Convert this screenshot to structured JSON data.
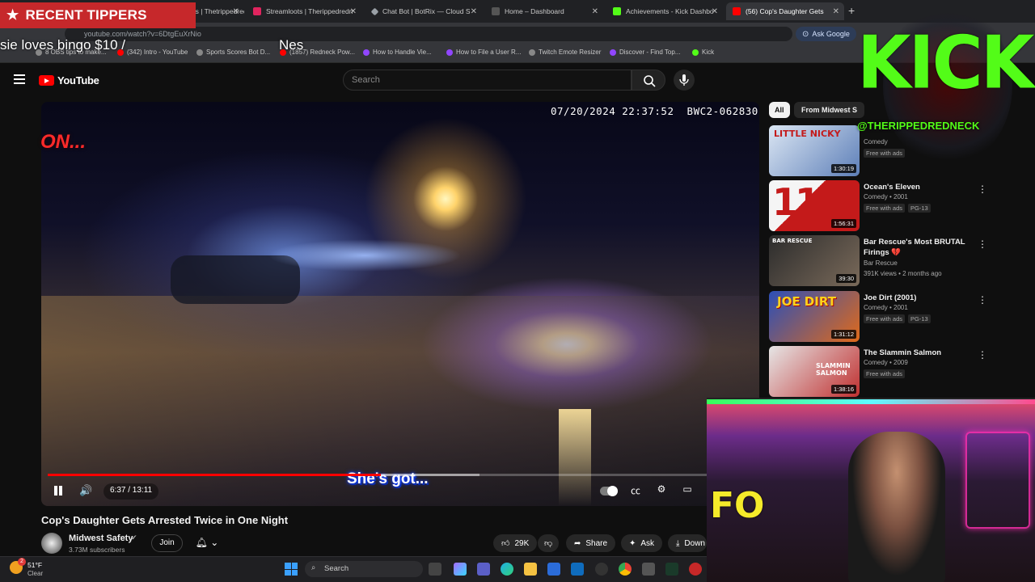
{
  "browser": {
    "tabs": [
      {
        "label": "Streamelements | Thetrippedred",
        "color": "#2f6df6"
      },
      {
        "label": "Streamloots | Therippedredn",
        "color": "#e0245e"
      },
      {
        "label": "Chat Bot | BotRix — Cloud S",
        "color": "#9aa0a6"
      },
      {
        "label": "Home – Dashboard",
        "color": "#3c3c3c"
      },
      {
        "label": "Achievements - Kick Dashbo",
        "color": "#53fc18"
      },
      {
        "label": "(56) Cop's Daughter Gets",
        "color": "#ff0000"
      }
    ],
    "url": "youtube.com/watch?v=6DtgEuXrNio",
    "ask_google": "Ask Google",
    "bookmarks": [
      "8 OBS tips to make...",
      "(342) Intro - YouTube",
      "Sports Scores Bot D...",
      "(1857) Redneck Pow...",
      "How to Handle Vie...",
      "How to File a User R...",
      "Twitch Emote Resizer",
      "Discover - Find Top...",
      "Kick"
    ]
  },
  "overlay": {
    "tippers_title": "RECENT TIPPERS",
    "tipper_ticker": "sie loves bingo $10 /",
    "tipper_ticker_next": "Nes",
    "kick_text": "KICK",
    "kick_handle": "@THERIPPEDREDNECK",
    "webcam_sign": "FO"
  },
  "youtube": {
    "logo": "YouTube",
    "search_placeholder": "Search",
    "video": {
      "timestamp": "07/20/2024 22:37:52  BWC2-062830",
      "on_text": "ON...",
      "caption": "She's got...",
      "time": "6:37 / 13:11",
      "progress": 0.505,
      "buffered": 0.655
    },
    "title": "Cop's Daughter Gets Arrested Twice in One Night",
    "channel": {
      "name": "Midwest Safety",
      "subscribers": "3.73M subscribers",
      "join": "Join"
    },
    "actions": {
      "likes": "29K",
      "share": "Share",
      "ask": "Ask",
      "download": "Down"
    },
    "chips": {
      "all": "All",
      "channel": "From Midwest S"
    },
    "recommendations": [
      {
        "title": "",
        "meta": "Comedy",
        "free": "Free with ads",
        "rating": "",
        "duration": "1:30:19",
        "thumb_text": "LITTLE NICKY",
        "thumb_colors": [
          "#dbe6f3",
          "#5d7fb8"
        ]
      },
      {
        "title": "Ocean's Eleven",
        "meta": "Comedy • 2001",
        "free": "Free with ads",
        "rating": "PG-13",
        "duration": "1:56:31",
        "thumb_text": "11",
        "thumb_colors": [
          "#f5f5f5",
          "#c41a1a"
        ]
      },
      {
        "title": "Bar Rescue's Most BRUTAL Firings 💔",
        "meta": "Bar Rescue",
        "free": "391K views • 2 months ago",
        "rating": "",
        "duration": "39:30",
        "thumb_text": "BAR RESCUE",
        "thumb_colors": [
          "#2c2c2c",
          "#7a6a5a"
        ]
      },
      {
        "title": "Joe Dirt (2001)",
        "meta": "Comedy • 2001",
        "free": "Free with ads",
        "rating": "PG-13",
        "duration": "1:31:12",
        "thumb_text": "JOE DIRT",
        "thumb_colors": [
          "#2b4fb8",
          "#e06a1a"
        ]
      },
      {
        "title": "The Slammin Salmon",
        "meta": "Comedy • 2009",
        "free": "Free with ads",
        "rating": "",
        "duration": "1:38:16",
        "thumb_text": "SLAMMIN SALMON",
        "thumb_colors": [
          "#e6e6e6",
          "#c03030"
        ]
      }
    ]
  },
  "taskbar": {
    "temperature": "51°F",
    "condition": "Clear",
    "notification_count": "2",
    "search_placeholder": "Search"
  }
}
